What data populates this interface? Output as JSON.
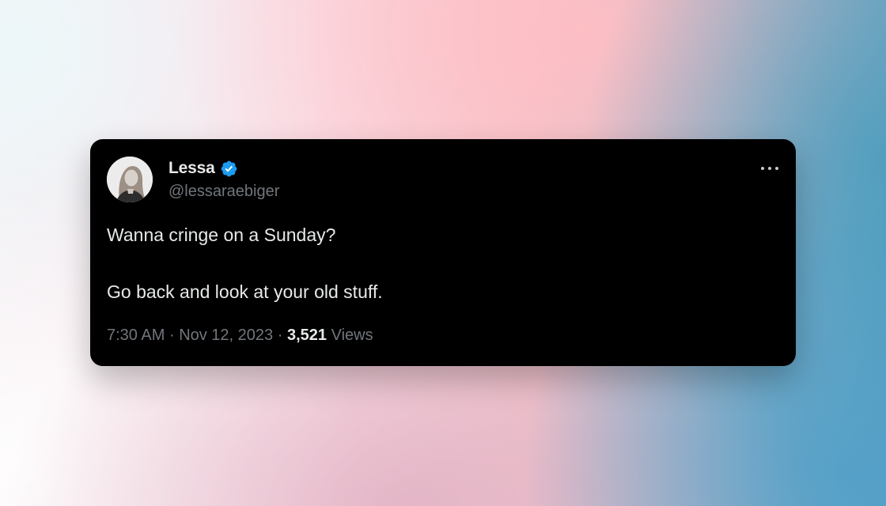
{
  "tweet": {
    "author": {
      "name": "Lessa",
      "handle": "@lessaraebiger",
      "verified": true,
      "verified_color": "#1d9bf0"
    },
    "text_lines": [
      "Wanna cringe on a Sunday?",
      "Go back and look at your old stuff."
    ],
    "time": "7:30 AM",
    "separator": "·",
    "date": "Nov 12, 2023",
    "views_count": "3,521",
    "views_label": "Views",
    "more_icon": "ellipsis-icon"
  },
  "colors": {
    "card_background": "#000000",
    "primary_text": "#e7e9ea",
    "secondary_text": "#71767b"
  }
}
